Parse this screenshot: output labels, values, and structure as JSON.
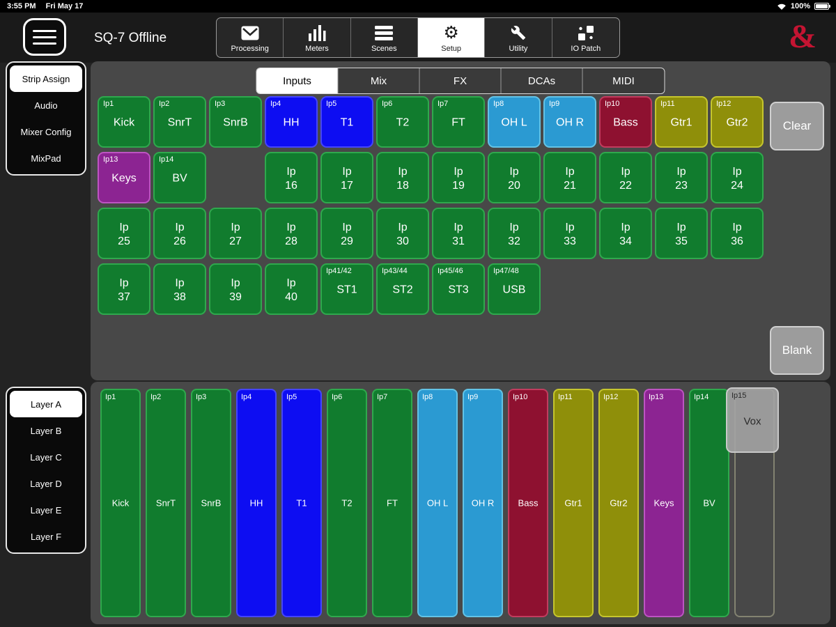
{
  "status_bar": {
    "time": "3:55 PM",
    "date": "Fri May 17",
    "battery": "100%"
  },
  "header": {
    "title": "SQ-7 Offline",
    "logo": "&",
    "toolbar": [
      {
        "label": "Processing",
        "icon": "processing-icon",
        "selected": false
      },
      {
        "label": "Meters",
        "icon": "meters-icon",
        "selected": false
      },
      {
        "label": "Scenes",
        "icon": "scenes-icon",
        "selected": false
      },
      {
        "label": "Setup",
        "icon": "gear-icon",
        "selected": true
      },
      {
        "label": "Utility",
        "icon": "wrench-icon",
        "selected": false
      },
      {
        "label": "IO Patch",
        "icon": "io-patch-icon",
        "selected": false
      }
    ]
  },
  "sidebar": {
    "items": [
      {
        "label": "Strip Assign",
        "selected": true
      },
      {
        "label": "Audio",
        "selected": false
      },
      {
        "label": "Mixer Config",
        "selected": false
      },
      {
        "label": "MixPad",
        "selected": false
      }
    ]
  },
  "tab_bar": {
    "tabs": [
      {
        "label": "Inputs",
        "selected": true
      },
      {
        "label": "Mix",
        "selected": false
      },
      {
        "label": "FX",
        "selected": false
      },
      {
        "label": "DCAs",
        "selected": false
      },
      {
        "label": "MIDI",
        "selected": false
      }
    ]
  },
  "buttons": {
    "clear": "Clear",
    "blank": "Blank"
  },
  "layers": {
    "items": [
      {
        "label": "Layer A",
        "selected": true
      },
      {
        "label": "Layer B",
        "selected": false
      },
      {
        "label": "Layer C",
        "selected": false
      },
      {
        "label": "Layer D",
        "selected": false
      },
      {
        "label": "Layer E",
        "selected": false
      },
      {
        "label": "Layer F",
        "selected": false
      }
    ]
  },
  "grid": {
    "rows": [
      [
        {
          "label": "Ip1",
          "name": "Kick",
          "color": "green"
        },
        {
          "label": "Ip2",
          "name": "SnrT",
          "color": "green"
        },
        {
          "label": "Ip3",
          "name": "SnrB",
          "color": "green"
        },
        {
          "label": "Ip4",
          "name": "HH",
          "color": "blue"
        },
        {
          "label": "Ip5",
          "name": "T1",
          "color": "blue"
        },
        {
          "label": "Ip6",
          "name": "T2",
          "color": "green"
        },
        {
          "label": "Ip7",
          "name": "FT",
          "color": "green"
        },
        {
          "label": "Ip8",
          "name": "OH L",
          "color": "cyan"
        },
        {
          "label": "Ip9",
          "name": "OH R",
          "color": "cyan"
        },
        {
          "label": "Ip10",
          "name": "Bass",
          "color": "crimson"
        },
        {
          "label": "Ip11",
          "name": "Gtr1",
          "color": "olive"
        },
        {
          "label": "Ip12",
          "name": "Gtr2",
          "color": "olive"
        }
      ],
      [
        {
          "label": "Ip13",
          "name": "Keys",
          "color": "purple"
        },
        {
          "label": "Ip14",
          "name": "BV",
          "color": "green"
        },
        null,
        {
          "name": "Ip 16",
          "color": "green",
          "center": true
        },
        {
          "name": "Ip 17",
          "color": "green",
          "center": true
        },
        {
          "name": "Ip 18",
          "color": "green",
          "center": true
        },
        {
          "name": "Ip 19",
          "color": "green",
          "center": true
        },
        {
          "name": "Ip 20",
          "color": "green",
          "center": true
        },
        {
          "name": "Ip 21",
          "color": "green",
          "center": true
        },
        {
          "name": "Ip 22",
          "color": "green",
          "center": true
        },
        {
          "name": "Ip 23",
          "color": "green",
          "center": true
        },
        {
          "name": "Ip 24",
          "color": "green",
          "center": true
        }
      ],
      [
        {
          "name": "Ip 25",
          "color": "green",
          "center": true
        },
        {
          "name": "Ip 26",
          "color": "green",
          "center": true
        },
        {
          "name": "Ip 27",
          "color": "green",
          "center": true
        },
        {
          "name": "Ip 28",
          "color": "green",
          "center": true
        },
        {
          "name": "Ip 29",
          "color": "green",
          "center": true
        },
        {
          "name": "Ip 30",
          "color": "green",
          "center": true
        },
        {
          "name": "Ip 31",
          "color": "green",
          "center": true
        },
        {
          "name": "Ip 32",
          "color": "green",
          "center": true
        },
        {
          "name": "Ip 33",
          "color": "green",
          "center": true
        },
        {
          "name": "Ip 34",
          "color": "green",
          "center": true
        },
        {
          "name": "Ip 35",
          "color": "green",
          "center": true
        },
        {
          "name": "Ip 36",
          "color": "green",
          "center": true
        }
      ],
      [
        {
          "name": "Ip 37",
          "color": "green",
          "center": true
        },
        {
          "name": "Ip 38",
          "color": "green",
          "center": true
        },
        {
          "name": "Ip 39",
          "color": "green",
          "center": true
        },
        {
          "name": "Ip 40",
          "color": "green",
          "center": true
        },
        {
          "label": "Ip41/42",
          "name": "ST1",
          "color": "green"
        },
        {
          "label": "Ip43/44",
          "name": "ST2",
          "color": "green"
        },
        {
          "label": "Ip45/46",
          "name": "ST3",
          "color": "green"
        },
        {
          "label": "Ip47/48",
          "name": "USB",
          "color": "green"
        }
      ]
    ]
  },
  "strips": [
    {
      "label": "Ip1",
      "name": "Kick",
      "color": "green"
    },
    {
      "label": "Ip2",
      "name": "SnrT",
      "color": "green"
    },
    {
      "label": "Ip3",
      "name": "SnrB",
      "color": "green"
    },
    {
      "label": "Ip4",
      "name": "HH",
      "color": "blue"
    },
    {
      "label": "Ip5",
      "name": "T1",
      "color": "blue"
    },
    {
      "label": "Ip6",
      "name": "T2",
      "color": "green"
    },
    {
      "label": "Ip7",
      "name": "FT",
      "color": "green"
    },
    {
      "label": "Ip8",
      "name": "OH L",
      "color": "cyan"
    },
    {
      "label": "Ip9",
      "name": "OH R",
      "color": "cyan"
    },
    {
      "label": "Ip10",
      "name": "Bass",
      "color": "crimson"
    },
    {
      "label": "Ip11",
      "name": "Gtr1",
      "color": "olive"
    },
    {
      "label": "Ip12",
      "name": "Gtr2",
      "color": "olive"
    },
    {
      "label": "Ip13",
      "name": "Keys",
      "color": "purple"
    },
    {
      "label": "Ip14",
      "name": "BV",
      "color": "green"
    }
  ],
  "ghost": {
    "label": "Ip15",
    "name": "Vox"
  },
  "colors": {
    "accent_red": "#c41432",
    "panel": "#484848",
    "channel": {
      "green": {
        "bg": "#117c2e",
        "border": "#2fa94d"
      },
      "blue": {
        "bg": "#0d0df2",
        "border": "#4545ff"
      },
      "cyan": {
        "bg": "#2b9ad2",
        "border": "#63c3e6"
      },
      "crimson": {
        "bg": "#8e1130",
        "border": "#c23c5e"
      },
      "olive": {
        "bg": "#8f8f0a",
        "border": "#c6c62e"
      },
      "purple": {
        "bg": "#8c2492",
        "border": "#bd54c2"
      },
      "gray": {
        "bg": "#9c9c9c",
        "border": "#d0d0d0"
      }
    }
  }
}
